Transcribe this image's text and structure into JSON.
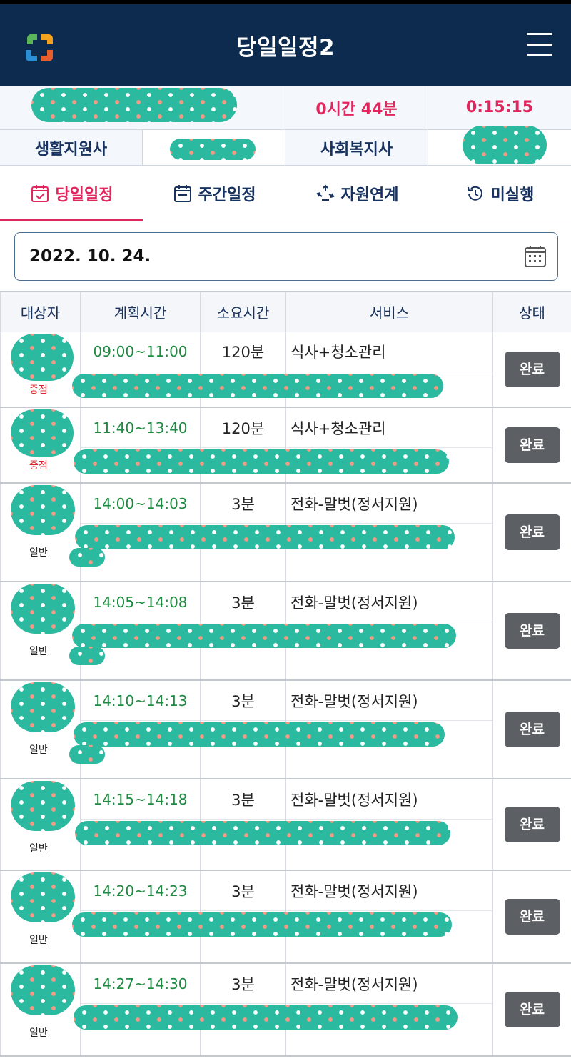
{
  "header": {
    "title": "당일일정2",
    "logo_icon": "app-logo-icon",
    "menu_icon": "hamburger-menu-icon"
  },
  "info": {
    "elapsed": "0시간 44분",
    "timer": "0:15:15",
    "label_worker": "생활지원사",
    "label_social": "사회복지사"
  },
  "tabs": [
    {
      "label": "당일일정",
      "icon": "calendar-check-icon",
      "active": true
    },
    {
      "label": "주간일정",
      "icon": "calendar-icon",
      "active": false
    },
    {
      "label": "자원연계",
      "icon": "recycle-icon",
      "active": false
    },
    {
      "label": "미실행",
      "icon": "history-icon",
      "active": false
    }
  ],
  "date": {
    "value": "2022. 10. 24.",
    "icon": "calendar-grid-icon"
  },
  "table": {
    "headers": [
      "대상자",
      "계획시간",
      "소요시간",
      "서비스",
      "상태"
    ],
    "rows": [
      {
        "badge": "중점",
        "time": "09:00~11:00",
        "duration": "120분",
        "service": "식사+청소관리",
        "status": "완료"
      },
      {
        "badge": "중점",
        "time": "11:40~13:40",
        "duration": "120분",
        "service": "식사+청소관리",
        "status": "완료"
      },
      {
        "badge": "일반",
        "time": "14:00~14:03",
        "duration": "3분",
        "service": "전화-말벗(정서지원)",
        "status": "완료"
      },
      {
        "badge": "일반",
        "time": "14:05~14:08",
        "duration": "3분",
        "service": "전화-말벗(정서지원)",
        "status": "완료"
      },
      {
        "badge": "일반",
        "time": "14:10~14:13",
        "duration": "3분",
        "service": "전화-말벗(정서지원)",
        "status": "완료"
      },
      {
        "badge": "일반",
        "time": "14:15~14:18",
        "duration": "3분",
        "service": "전화-말벗(정서지원)",
        "status": "완료"
      },
      {
        "badge": "일반",
        "time": "14:20~14:23",
        "duration": "3분",
        "service": "전화-말벗(정서지원)",
        "status": "완료"
      },
      {
        "badge": "일반",
        "time": "14:27~14:30",
        "duration": "3분",
        "service": "전화-말벗(정서지원)",
        "status": "완료"
      }
    ]
  },
  "colors": {
    "header_bg": "#0d2a4f",
    "accent": "#e0265d",
    "time_green": "#1d8a3f",
    "button_gray": "#5c5f63",
    "redaction": "#2bb9a0"
  }
}
